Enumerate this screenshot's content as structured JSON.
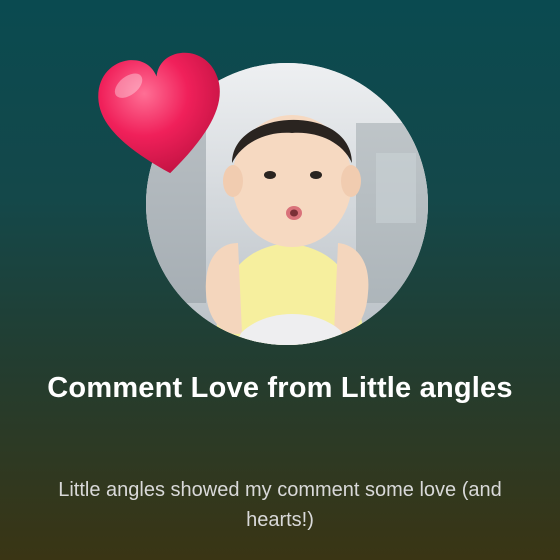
{
  "notification": {
    "title": "Comment Love from Little angles",
    "subtitle": "Little angles showed my comment some love (and hearts!)"
  },
  "icons": {
    "avatar": "baby-avatar",
    "reaction": "heart-icon"
  },
  "colors": {
    "background_top": "#0a4a50",
    "background_bottom": "#3a3514",
    "heart": "#f0205a",
    "title": "#ffffff",
    "subtitle": "#d9d9d9"
  }
}
